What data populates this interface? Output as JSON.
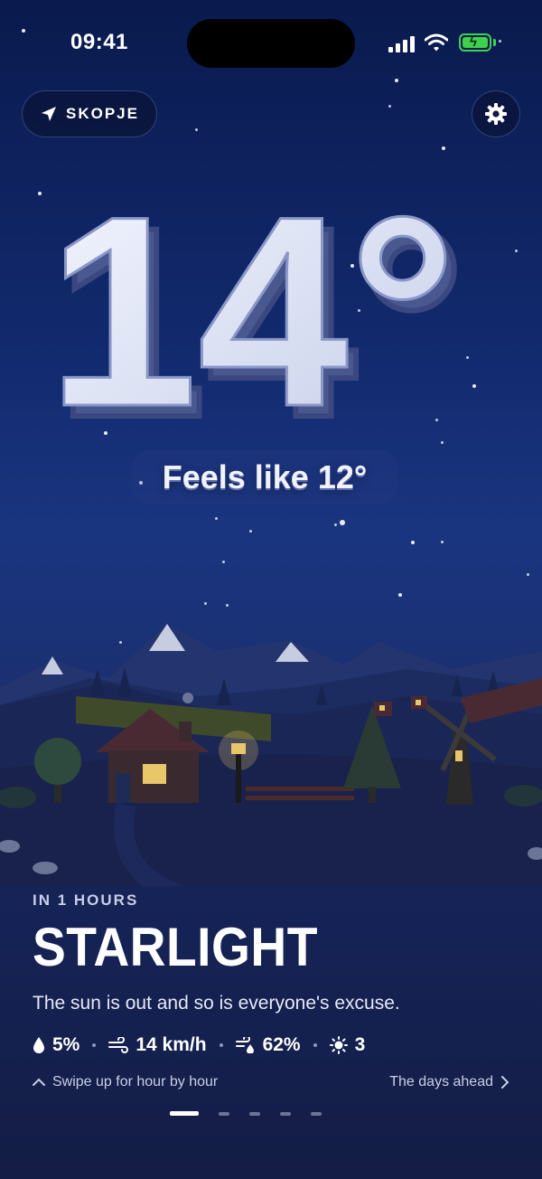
{
  "status_bar": {
    "time": "09:41"
  },
  "location": {
    "name": "SKOPJE"
  },
  "weather": {
    "temperature": "14°",
    "feels_like": "Feels like 12°",
    "eyebrow": "IN 1 HOURS",
    "headline": "STARLIGHT",
    "description": "The sun is out and so is everyone's excuse.",
    "precipitation": "5%",
    "wind": "14 km/h",
    "humidity": "62%",
    "uv": "3"
  },
  "nav": {
    "swipe_hint": "Swipe up for hour by hour",
    "days_ahead": "The days ahead",
    "page_count": 5,
    "active_page": 1
  },
  "colors": {
    "accent": "#3fd14c",
    "sky_top": "#0a1a4e",
    "sky_bottom": "#131d45"
  }
}
